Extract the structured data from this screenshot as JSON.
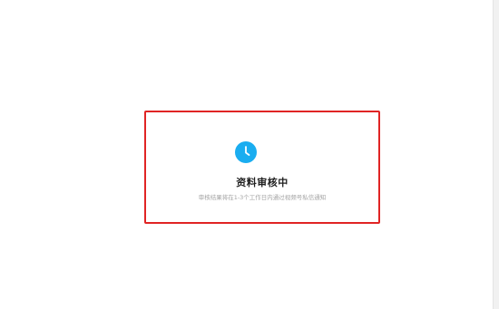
{
  "review_status": {
    "icon": "clock-icon",
    "icon_color": "#1aadf0",
    "border_color": "#e02424",
    "title": "资料审核中",
    "description": "审核结果将在1-3个工作日内通过视频号私信通知"
  }
}
